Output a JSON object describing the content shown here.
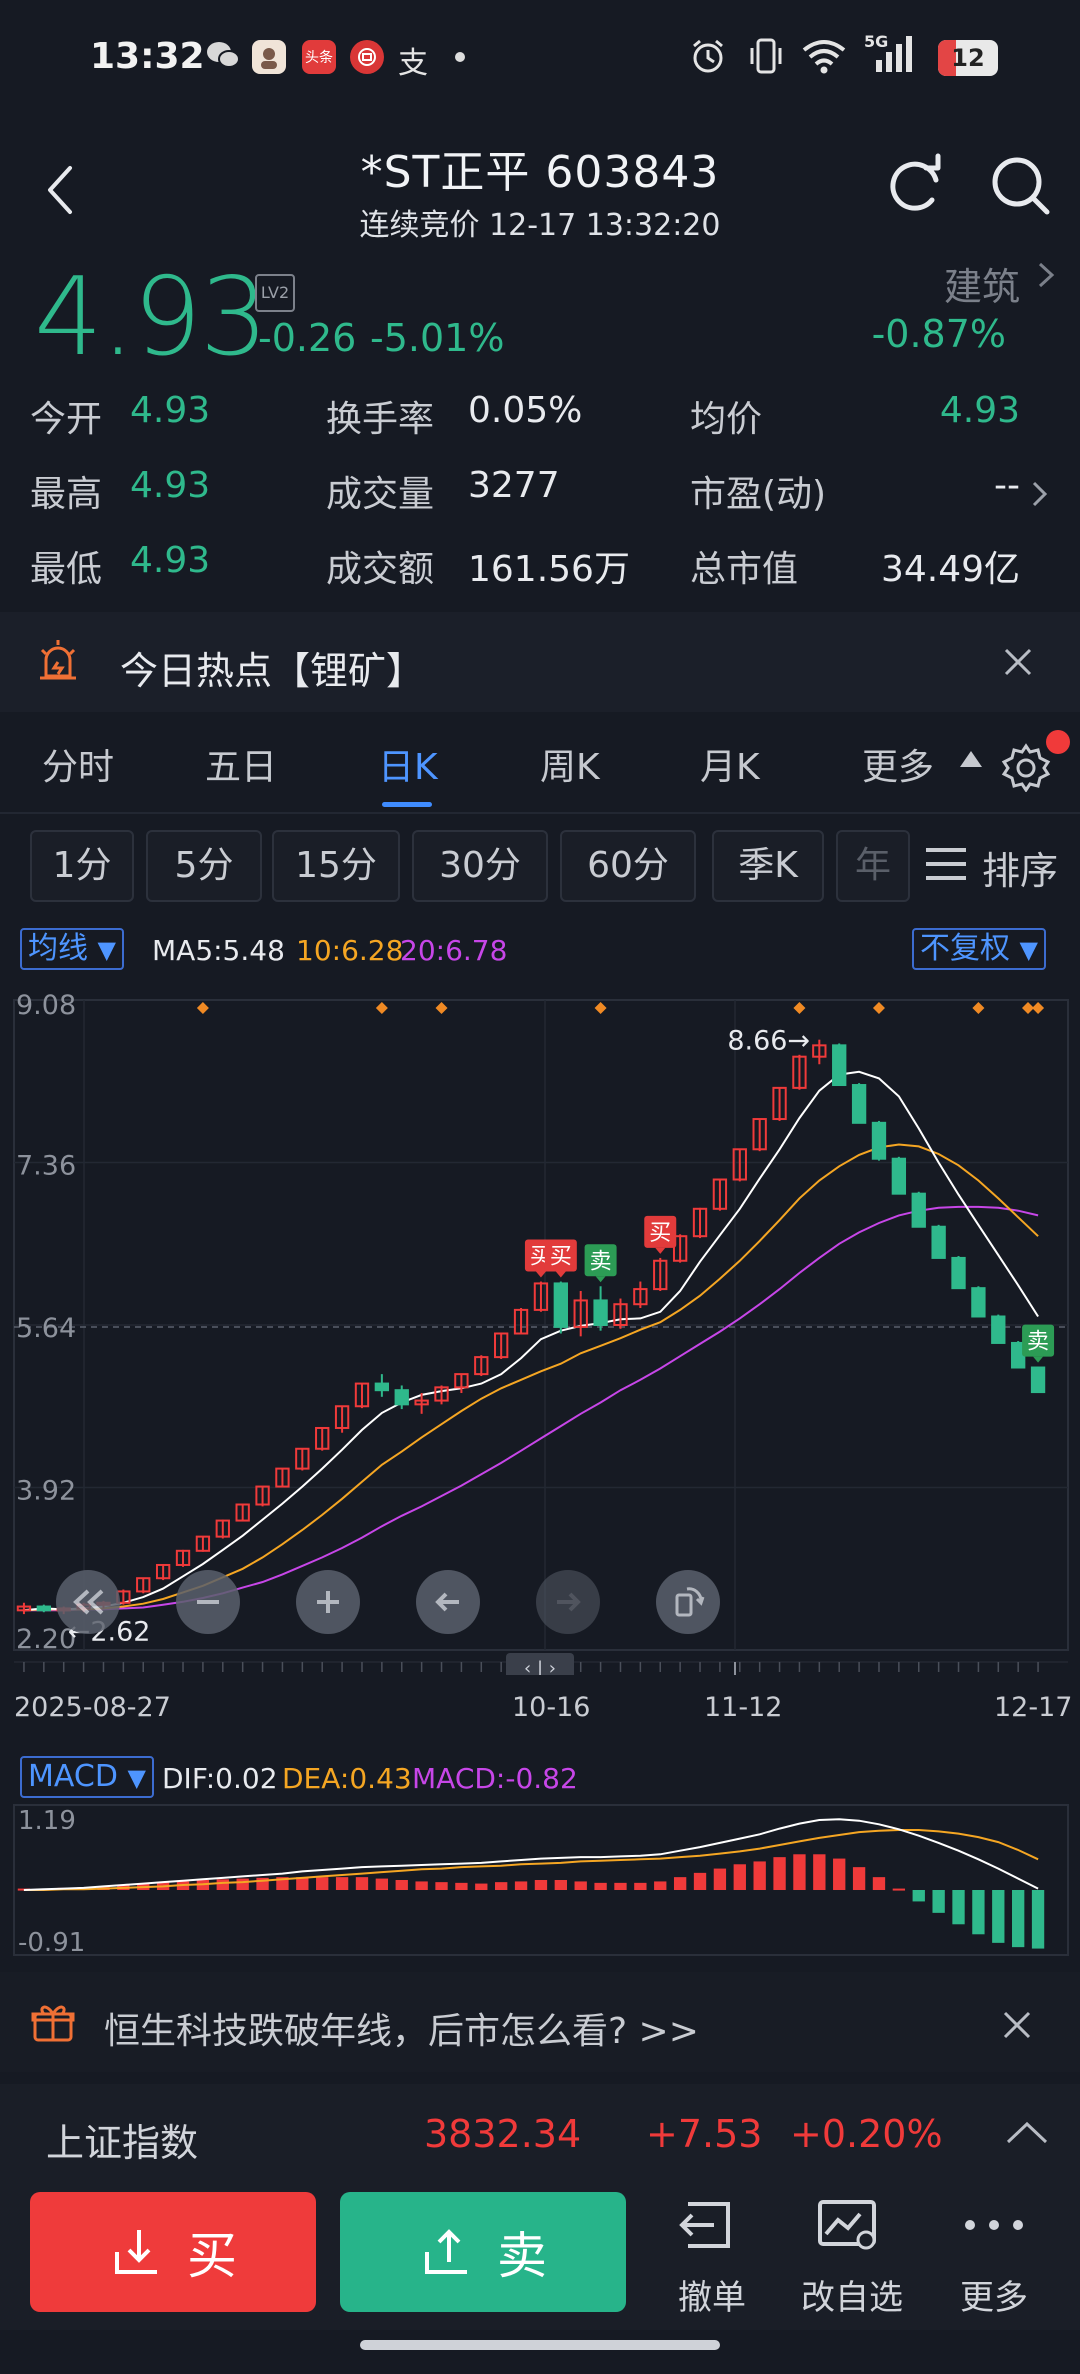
{
  "status_bar": {
    "time": "13:32",
    "battery": "12",
    "network": "5G"
  },
  "header": {
    "title": "*ST正平 603843",
    "subtitle": "连续竞价 12-17 13:32:20"
  },
  "quote": {
    "price": "4.93",
    "level_badge": "LV2",
    "change": "-0.26",
    "change_pct": "-5.01%",
    "sector": "建筑",
    "sector_change": "-0.87%",
    "stats": [
      [
        {
          "label": "今开",
          "value": "4.93",
          "color": "green"
        },
        {
          "label": "换手率",
          "value": "0.05%",
          "color": "white"
        },
        {
          "label": "均价",
          "value": "4.93",
          "color": "green"
        }
      ],
      [
        {
          "label": "最高",
          "value": "4.93",
          "color": "green"
        },
        {
          "label": "成交量",
          "value": "3277",
          "color": "white"
        },
        {
          "label": "市盈(动)",
          "value": "--",
          "color": "white"
        }
      ],
      [
        {
          "label": "最低",
          "value": "4.93",
          "color": "green"
        },
        {
          "label": "成交额",
          "value": "161.56万",
          "color": "white"
        },
        {
          "label": "总市值",
          "value": "34.49亿",
          "color": "white"
        }
      ]
    ]
  },
  "hot_topic": {
    "text": "今日热点【锂矿】"
  },
  "tabs": [
    "分时",
    "五日",
    "日K",
    "周K",
    "月K",
    "更多"
  ],
  "active_tab": "日K",
  "periods": [
    "1分",
    "5分",
    "15分",
    "30分",
    "60分",
    "季K",
    "年"
  ],
  "sort_label": "排序",
  "chart_controls": {
    "ma_selector": "均线",
    "adj_selector": "不复权",
    "ma5": "MA5:5.48",
    "ma10": "10:6.28",
    "ma20": "20:6.78",
    "macd_selector": "MACD",
    "dif": "DIF:0.02",
    "dea": "DEA:0.43",
    "macd": "MACD:-0.82"
  },
  "chart_data": {
    "type": "candlestick",
    "y_ticks": [
      "9.08",
      "7.36",
      "5.64",
      "3.92",
      "2.20"
    ],
    "ylim": [
      2.2,
      9.08
    ],
    "x_dates": [
      "2025-08-27",
      "10-16",
      "11-12",
      "12-17"
    ],
    "annotations": {
      "high": "8.66→",
      "low": "←2.62"
    },
    "signals": {
      "buy": "买",
      "sell": "卖"
    },
    "colors": {
      "up": "#f03a3a",
      "down": "#2fb98c",
      "ma5": "#ffffff",
      "ma10": "#f5a623",
      "ma20": "#c746e8"
    },
    "candles": [
      [
        2.62,
        2.7,
        2.58,
        2.66
      ],
      [
        2.66,
        2.68,
        2.6,
        2.62
      ],
      [
        2.62,
        2.66,
        2.58,
        2.64
      ],
      [
        2.64,
        2.7,
        2.6,
        2.68
      ],
      [
        2.68,
        2.72,
        2.64,
        2.7
      ],
      [
        2.7,
        2.84,
        2.68,
        2.82
      ],
      [
        2.82,
        2.96,
        2.8,
        2.96
      ],
      [
        2.96,
        3.1,
        2.94,
        3.1
      ],
      [
        3.1,
        3.26,
        3.08,
        3.25
      ],
      [
        3.25,
        3.4,
        3.24,
        3.4
      ],
      [
        3.4,
        3.58,
        3.38,
        3.57
      ],
      [
        3.57,
        3.74,
        3.56,
        3.74
      ],
      [
        3.74,
        3.93,
        3.72,
        3.93
      ],
      [
        3.93,
        4.12,
        3.92,
        4.12
      ],
      [
        4.12,
        4.33,
        4.1,
        4.33
      ],
      [
        4.33,
        4.55,
        4.31,
        4.55
      ],
      [
        4.55,
        4.78,
        4.5,
        4.78
      ],
      [
        4.78,
        5.02,
        4.76,
        5.02
      ],
      [
        5.02,
        5.12,
        4.88,
        4.95
      ],
      [
        4.95,
        5.0,
        4.75,
        4.8
      ],
      [
        4.8,
        4.92,
        4.7,
        4.84
      ],
      [
        4.84,
        5.0,
        4.8,
        4.98
      ],
      [
        4.98,
        5.12,
        4.92,
        5.12
      ],
      [
        5.12,
        5.32,
        5.1,
        5.3
      ],
      [
        5.3,
        5.56,
        5.28,
        5.55
      ],
      [
        5.55,
        5.82,
        5.54,
        5.8
      ],
      [
        5.8,
        6.1,
        5.78,
        6.08
      ],
      [
        6.08,
        6.1,
        5.55,
        5.62
      ],
      [
        5.62,
        6.0,
        5.52,
        5.9
      ],
      [
        5.9,
        6.05,
        5.58,
        5.64
      ],
      [
        5.64,
        5.92,
        5.6,
        5.86
      ],
      [
        5.86,
        6.1,
        5.82,
        6.02
      ],
      [
        6.02,
        6.35,
        6.0,
        6.32
      ],
      [
        6.32,
        6.6,
        6.3,
        6.58
      ],
      [
        6.58,
        6.88,
        6.56,
        6.87
      ],
      [
        6.87,
        7.18,
        6.85,
        7.18
      ],
      [
        7.18,
        7.5,
        7.16,
        7.5
      ],
      [
        7.5,
        7.82,
        7.48,
        7.82
      ],
      [
        7.82,
        8.15,
        7.8,
        8.15
      ],
      [
        8.15,
        8.5,
        8.13,
        8.48
      ],
      [
        8.48,
        8.66,
        8.4,
        8.6
      ],
      [
        8.6,
        8.62,
        8.18,
        8.18
      ],
      [
        8.18,
        8.2,
        7.78,
        7.78
      ],
      [
        7.78,
        7.8,
        7.38,
        7.4
      ],
      [
        7.4,
        7.42,
        7.03,
        7.03
      ],
      [
        7.03,
        7.05,
        6.68,
        6.68
      ],
      [
        6.68,
        6.7,
        6.35,
        6.35
      ],
      [
        6.35,
        6.37,
        6.03,
        6.03
      ],
      [
        6.03,
        6.05,
        5.73,
        5.73
      ],
      [
        5.73,
        5.75,
        5.45,
        5.45
      ],
      [
        5.45,
        5.47,
        5.19,
        5.19
      ],
      [
        5.19,
        5.2,
        4.93,
        4.93
      ]
    ],
    "ma5": [
      2.62,
      2.64,
      2.63,
      2.64,
      2.66,
      2.7,
      2.76,
      2.85,
      2.98,
      3.11,
      3.26,
      3.41,
      3.58,
      3.75,
      3.93,
      4.12,
      4.32,
      4.53,
      4.71,
      4.82,
      4.9,
      4.94,
      4.97,
      5.02,
      5.12,
      5.29,
      5.49,
      5.58,
      5.63,
      5.66,
      5.7,
      5.71,
      5.78,
      6.0,
      6.31,
      6.59,
      6.87,
      7.19,
      7.5,
      7.83,
      8.12,
      8.29,
      8.32,
      8.25,
      8.06,
      7.72,
      7.36,
      7.02,
      6.7,
      6.38,
      6.06,
      5.73
    ],
    "ma10": [
      2.62,
      2.63,
      2.63,
      2.63,
      2.64,
      2.66,
      2.69,
      2.74,
      2.81,
      2.88,
      2.97,
      3.06,
      3.18,
      3.32,
      3.47,
      3.63,
      3.8,
      3.98,
      4.16,
      4.3,
      4.45,
      4.59,
      4.73,
      4.86,
      4.97,
      5.06,
      5.15,
      5.23,
      5.34,
      5.42,
      5.5,
      5.59,
      5.67,
      5.8,
      5.95,
      6.13,
      6.32,
      6.53,
      6.75,
      6.98,
      7.17,
      7.32,
      7.44,
      7.52,
      7.55,
      7.53,
      7.45,
      7.33,
      7.17,
      6.98,
      6.78,
      6.58
    ],
    "ma20": [
      2.62,
      2.62,
      2.62,
      2.63,
      2.63,
      2.64,
      2.65,
      2.68,
      2.71,
      2.75,
      2.8,
      2.86,
      2.92,
      3.0,
      3.09,
      3.18,
      3.28,
      3.39,
      3.51,
      3.62,
      3.72,
      3.83,
      3.94,
      4.06,
      4.18,
      4.31,
      4.44,
      4.57,
      4.7,
      4.82,
      4.95,
      5.06,
      5.18,
      5.31,
      5.44,
      5.57,
      5.71,
      5.86,
      6.02,
      6.19,
      6.35,
      6.5,
      6.62,
      6.72,
      6.8,
      6.85,
      6.88,
      6.89,
      6.89,
      6.88,
      6.85,
      6.8
    ],
    "buy_signals": [
      26,
      27,
      32
    ],
    "sell_signals": [
      29,
      51
    ],
    "macd": {
      "y_ticks": [
        "1.19",
        "-0.91"
      ],
      "ylim": [
        -0.91,
        1.19
      ],
      "dif": [
        0.0,
        0.01,
        0.02,
        0.03,
        0.05,
        0.07,
        0.09,
        0.11,
        0.13,
        0.15,
        0.17,
        0.19,
        0.21,
        0.23,
        0.26,
        0.28,
        0.3,
        0.32,
        0.33,
        0.34,
        0.35,
        0.36,
        0.37,
        0.38,
        0.4,
        0.42,
        0.44,
        0.45,
        0.46,
        0.46,
        0.47,
        0.48,
        0.5,
        0.55,
        0.6,
        0.66,
        0.72,
        0.78,
        0.86,
        0.93,
        0.98,
        0.99,
        0.97,
        0.92,
        0.85,
        0.76,
        0.66,
        0.55,
        0.43,
        0.3,
        0.16,
        0.02
      ],
      "dea": [
        0.0,
        0.0,
        0.01,
        0.01,
        0.02,
        0.03,
        0.04,
        0.05,
        0.07,
        0.08,
        0.1,
        0.11,
        0.13,
        0.15,
        0.17,
        0.19,
        0.21,
        0.23,
        0.25,
        0.27,
        0.29,
        0.3,
        0.32,
        0.33,
        0.34,
        0.36,
        0.37,
        0.38,
        0.4,
        0.41,
        0.42,
        0.43,
        0.44,
        0.46,
        0.48,
        0.51,
        0.54,
        0.58,
        0.63,
        0.68,
        0.73,
        0.77,
        0.81,
        0.83,
        0.84,
        0.84,
        0.82,
        0.79,
        0.74,
        0.67,
        0.56,
        0.43
      ],
      "hist": [
        0.02,
        0.02,
        0.03,
        0.04,
        0.05,
        0.07,
        0.09,
        0.11,
        0.12,
        0.14,
        0.15,
        0.16,
        0.17,
        0.18,
        0.18,
        0.18,
        0.18,
        0.18,
        0.16,
        0.14,
        0.12,
        0.11,
        0.1,
        0.09,
        0.11,
        0.12,
        0.14,
        0.14,
        0.12,
        0.1,
        0.1,
        0.1,
        0.12,
        0.18,
        0.24,
        0.3,
        0.36,
        0.4,
        0.46,
        0.5,
        0.5,
        0.44,
        0.32,
        0.18,
        0.02,
        -0.16,
        -0.32,
        -0.48,
        -0.62,
        -0.74,
        -0.8,
        -0.82
      ]
    }
  },
  "news_banner": {
    "text": "恒生科技跌破年线，后市怎么看? >>"
  },
  "index_bar": {
    "name": "上证指数",
    "value": "3832.34",
    "change": "+7.53",
    "change_pct": "+0.20%"
  },
  "bottom_actions": {
    "buy": "买",
    "sell": "卖",
    "cancel": "撤单",
    "edit_watch": "改自选",
    "more": "更多"
  }
}
